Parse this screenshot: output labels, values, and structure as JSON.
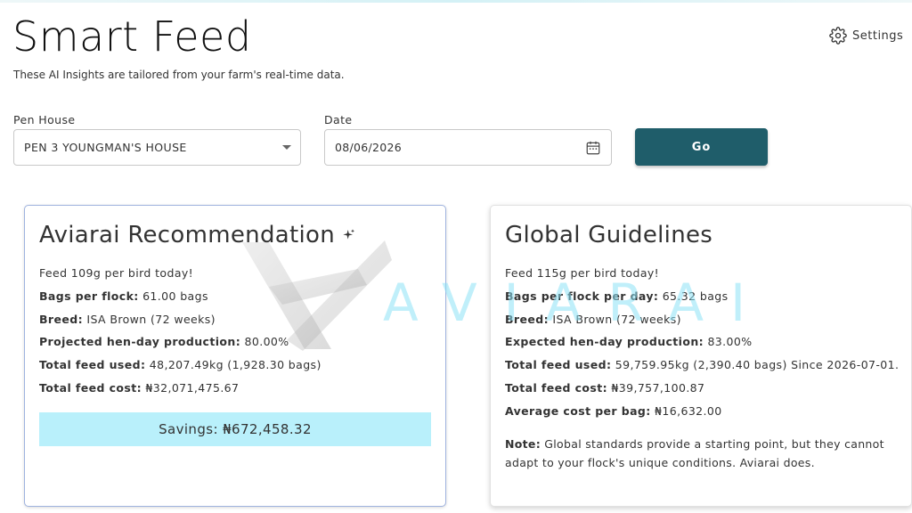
{
  "header": {
    "title": "Smart Feed",
    "subtitle": "These AI Insights are tailored from your farm's real-time data.",
    "settings_label": "Settings"
  },
  "filters": {
    "pen_house_label": "Pen House",
    "pen_house_value": "PEN 3 YOUNGMAN'S HOUSE",
    "date_label": "Date",
    "date_value": "08/06/2026",
    "go_label": "Go"
  },
  "recommendation": {
    "title": "Aviarai Recommendation",
    "feed_line": "Feed 109g per bird today!",
    "bags_label": "Bags per flock:",
    "bags_value": "61.00 bags",
    "breed_label": "Breed:",
    "breed_value": "ISA Brown (72 weeks)",
    "production_label": "Projected hen-day production:",
    "production_value": "80.00%",
    "feed_used_label": "Total feed used:",
    "feed_used_value": "48,207.49kg (1,928.30 bags)",
    "feed_cost_label": "Total feed cost:",
    "feed_cost_value": "₦32,071,475.67",
    "savings": "Savings: ₦672,458.32"
  },
  "guidelines": {
    "title": "Global Guidelines",
    "feed_line": "Feed 115g per bird today!",
    "bags_label": "Bags per flock per day:",
    "bags_value": "65.32 bags",
    "breed_label": "Breed:",
    "breed_value": "ISA Brown (72 weeks)",
    "production_label": "Expected hen-day production:",
    "production_value": "83.00%",
    "feed_used_label": "Total feed used:",
    "feed_used_value": "59,759.95kg (2,390.40 bags) Since 2026-07-01.",
    "feed_cost_label": "Total feed cost:",
    "feed_cost_value": "₦39,757,100.87",
    "avg_cost_label": "Average cost per bag:",
    "avg_cost_value": "₦16,632.00",
    "note_label": "Note:",
    "note_text": "Global standards provide a starting point, but they cannot adapt to your flock's unique conditions. Aviarai does."
  },
  "watermark": {
    "text": "AVIARAI"
  },
  "icons": {
    "settings": "gear-icon",
    "calendar": "calendar-icon",
    "sparkle": "sparkle-icon",
    "dropdown": "chevron-down-icon"
  },
  "colors": {
    "primary_button": "#1f5d6a",
    "savings_bg": "#b9f0fb",
    "watermark": "#8ce2f6"
  }
}
